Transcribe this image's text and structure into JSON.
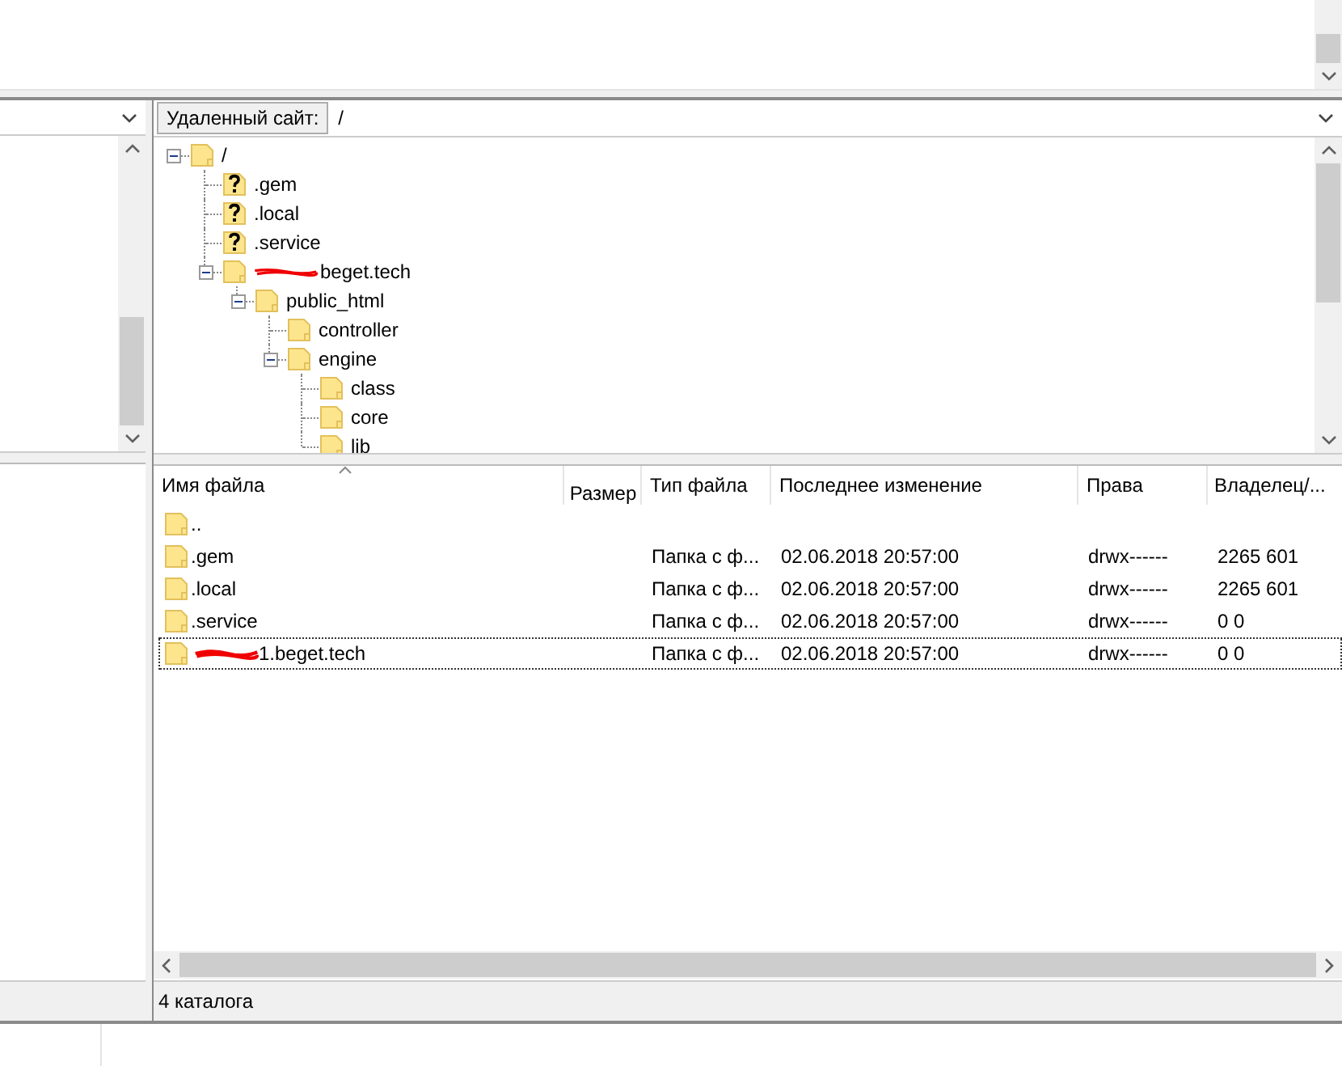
{
  "remote_site": {
    "label": "Удаленный сайт:",
    "path": "/"
  },
  "tree": [
    {
      "name": "/",
      "kind": "folder",
      "expanded": true,
      "redacted": false,
      "children": [
        {
          "name": ".gem",
          "kind": "unknown",
          "redacted": false
        },
        {
          "name": ".local",
          "kind": "unknown",
          "redacted": false
        },
        {
          "name": ".service",
          "kind": "unknown",
          "redacted": false
        },
        {
          "name": "beget.tech",
          "kind": "folder",
          "expanded": true,
          "redacted": true,
          "children": [
            {
              "name": "public_html",
              "kind": "folder",
              "expanded": true,
              "redacted": false,
              "children": [
                {
                  "name": "controller",
                  "kind": "folder",
                  "redacted": false
                },
                {
                  "name": "engine",
                  "kind": "folder",
                  "expanded": true,
                  "redacted": false,
                  "children": [
                    {
                      "name": "class",
                      "kind": "folder",
                      "redacted": false
                    },
                    {
                      "name": "core",
                      "kind": "folder",
                      "redacted": false
                    },
                    {
                      "name": "lib",
                      "kind": "folder",
                      "redacted": false
                    }
                  ]
                }
              ]
            }
          ]
        }
      ]
    }
  ],
  "file_list": {
    "columns": [
      "Имя файла",
      "Размер",
      "Тип файла",
      "Последнее изменение",
      "Права",
      "Владелец/..."
    ],
    "rows": [
      {
        "name": "..",
        "focused": false,
        "redacted": false
      },
      {
        "name": ".gem",
        "type": "Папка с ф...",
        "modified": "02.06.2018 20:57:00",
        "permissions": "drwx------",
        "owner": "2265 601",
        "focused": false,
        "redacted": false
      },
      {
        "name": ".local",
        "type": "Папка с ф...",
        "modified": "02.06.2018 20:57:00",
        "permissions": "drwx------",
        "owner": "2265 601",
        "focused": false,
        "redacted": false
      },
      {
        "name": ".service",
        "type": "Папка с ф...",
        "modified": "02.06.2018 20:57:00",
        "permissions": "drwx------",
        "owner": "0 0",
        "focused": false,
        "redacted": false
      },
      {
        "name": "1.beget.tech",
        "type": "Папка с ф...",
        "modified": "02.06.2018 20:57:00",
        "permissions": "drwx------",
        "owner": "0 0",
        "focused": true,
        "redacted": true
      }
    ]
  },
  "status": "4 каталога"
}
